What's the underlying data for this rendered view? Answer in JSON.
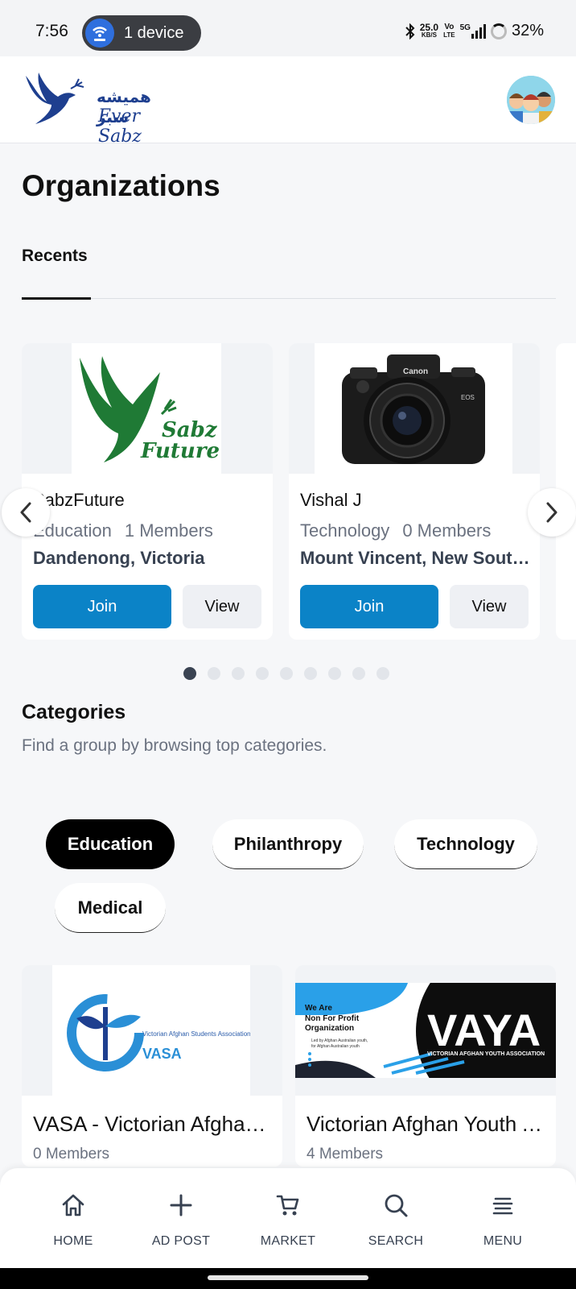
{
  "status_bar": {
    "time": "7:56",
    "hotspot_label": "1 device",
    "net_speed_value": "25.0",
    "net_speed_unit": "KB/S",
    "volte_top": "Vo",
    "volte_bottom": "LTE",
    "network": "5G",
    "battery": "32%"
  },
  "header": {
    "brand_fa": "همیشه سبز",
    "brand_en": "Ever Sabz"
  },
  "page": {
    "title": "Organizations",
    "tab": "Recents"
  },
  "recent_orgs": [
    {
      "name": "SabzFuture",
      "category": "Education",
      "members": "1 Members",
      "location": "Dandenong, Victoria",
      "join_label": "Join",
      "view_label": "View",
      "logo_text_1": "Sabz",
      "logo_text_2": "Future"
    },
    {
      "name": "Vishal J",
      "category": "Technology",
      "members": "0 Members",
      "location": "Mount Vincent, New South Wales",
      "join_label": "Join",
      "view_label": "View",
      "camera_brand": "Canon",
      "camera_model": "EOS"
    }
  ],
  "carousel": {
    "total_dots": 9,
    "active_dot": 0
  },
  "categories": {
    "title": "Categories",
    "subtitle": "Find a group by browsing top categories.",
    "chips": [
      "Education",
      "Philanthropy",
      "Technology",
      "Medical"
    ],
    "active": "Education"
  },
  "groups": [
    {
      "name": "VASA - Victorian Afghan Students Association",
      "members": "0 Members",
      "logo_caption": "Victorian Afghan Students Association",
      "logo_abbr": "VASA"
    },
    {
      "name": "Victorian Afghan Youth Association",
      "members": "4 Members",
      "banner_line1": "We Are",
      "banner_line2": "Non For Profit",
      "banner_line3": "Organization",
      "banner_line4": "Led by Afghan Australian youth,",
      "banner_line5": "for Afghan Australian youth",
      "logo_abbr": "VAYA",
      "logo_caption": "VICTORIAN AFGHAN YOUTH ASSOCIATION"
    }
  ],
  "bottom_nav": [
    {
      "label": "HOME",
      "icon": "home-icon"
    },
    {
      "label": "AD POST",
      "icon": "plus-icon"
    },
    {
      "label": "MARKET",
      "icon": "cart-icon"
    },
    {
      "label": "SEARCH",
      "icon": "search-icon"
    },
    {
      "label": "MENU",
      "icon": "menu-icon"
    }
  ],
  "colors": {
    "primary": "#0b83c7",
    "brand_green": "#1f7a35",
    "brand_blue": "#1e3f8f"
  }
}
